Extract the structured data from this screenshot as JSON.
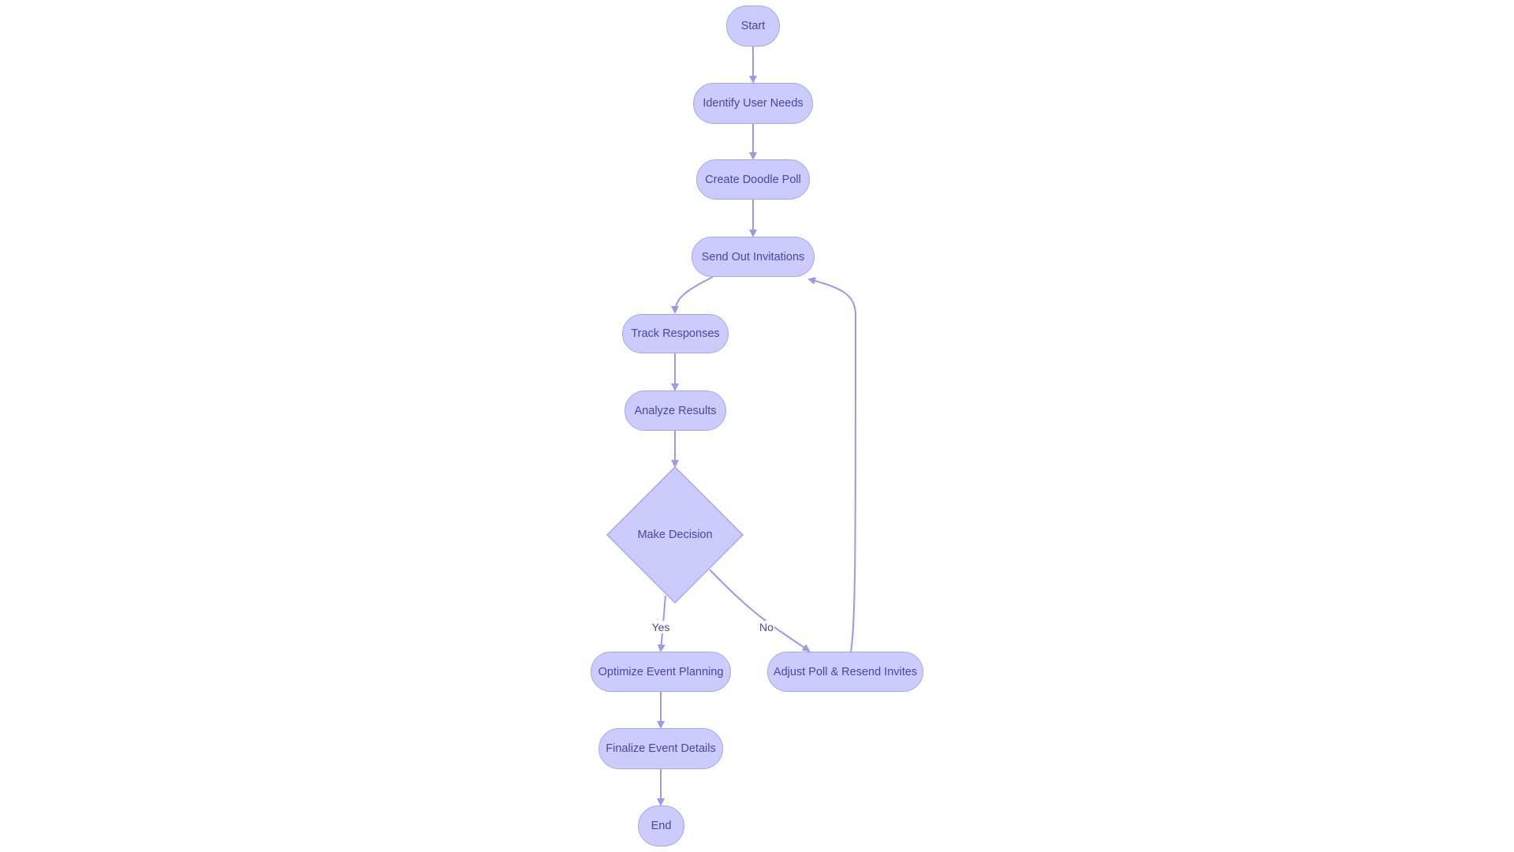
{
  "colors": {
    "node_fill": "#cbcbfd",
    "node_stroke": "#a6a6ee",
    "text": "#4646ac",
    "edge": "#9a9ae6"
  },
  "nodes": {
    "start": "Start",
    "identify": "Identify User Needs",
    "create": "Create Doodle Poll",
    "send": "Send Out Invitations",
    "track": "Track Responses",
    "analyze": "Analyze Results",
    "decision": "Make Decision",
    "optimize": "Optimize Event Planning",
    "adjust": "Adjust Poll & Resend Invites",
    "finalize": "Finalize Event Details",
    "end": "End"
  },
  "edge_labels": {
    "yes": "Yes",
    "no": "No"
  }
}
